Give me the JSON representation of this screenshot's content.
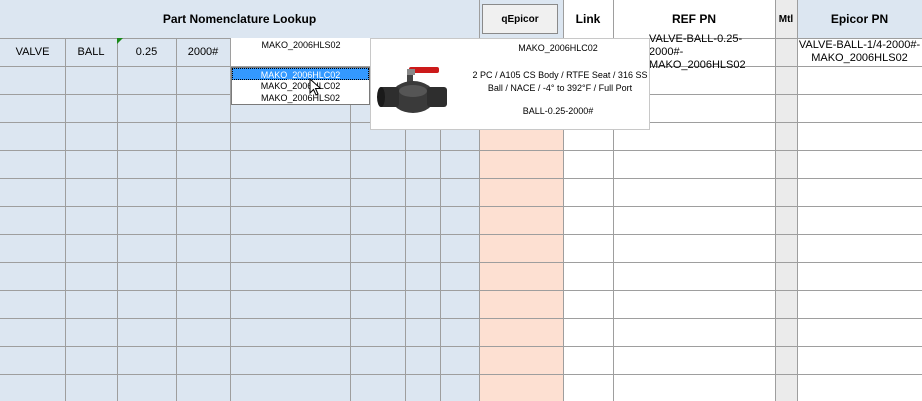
{
  "header": {
    "title": "Part Nomenclature Lookup",
    "qepicor_button": "qEpicor",
    "link": "Link",
    "ref_pn": "REF PN",
    "mtl": "Mtl",
    "epicor_pn": "Epicor PN"
  },
  "row1": {
    "c1": "VALVE",
    "c2": "BALL",
    "c3": "0.25",
    "c4": "2000#",
    "dropdown_value": "MAKO_2006HLS02",
    "ref_pn": "VALVE-BALL-0.25-2000#-\nMAKO_2006HLS02",
    "epicor_pn": "VALVE-BALL-1/4-2000#-\nMAKO_2006HLS02"
  },
  "dropdown": {
    "items": [
      "MAKO_2006HLC02",
      "MAKO_2006HLC02",
      "MAKO_2006HLS02"
    ]
  },
  "preview": {
    "part": "MAKO_2006HLC02",
    "description": "2 PC / A105 CS Body / RTFE Seat / 316 SS Ball / NACE / -4° to 392°F / Full Port",
    "code": "BALL-0.25-2000#"
  },
  "colors": {
    "header_bg": "#dce6f1",
    "qepicor_col_bg": "#fde0d2",
    "mtl_col_bg": "#ebebeb",
    "grid": "#9e9e9e",
    "selected": "#3399ff"
  }
}
